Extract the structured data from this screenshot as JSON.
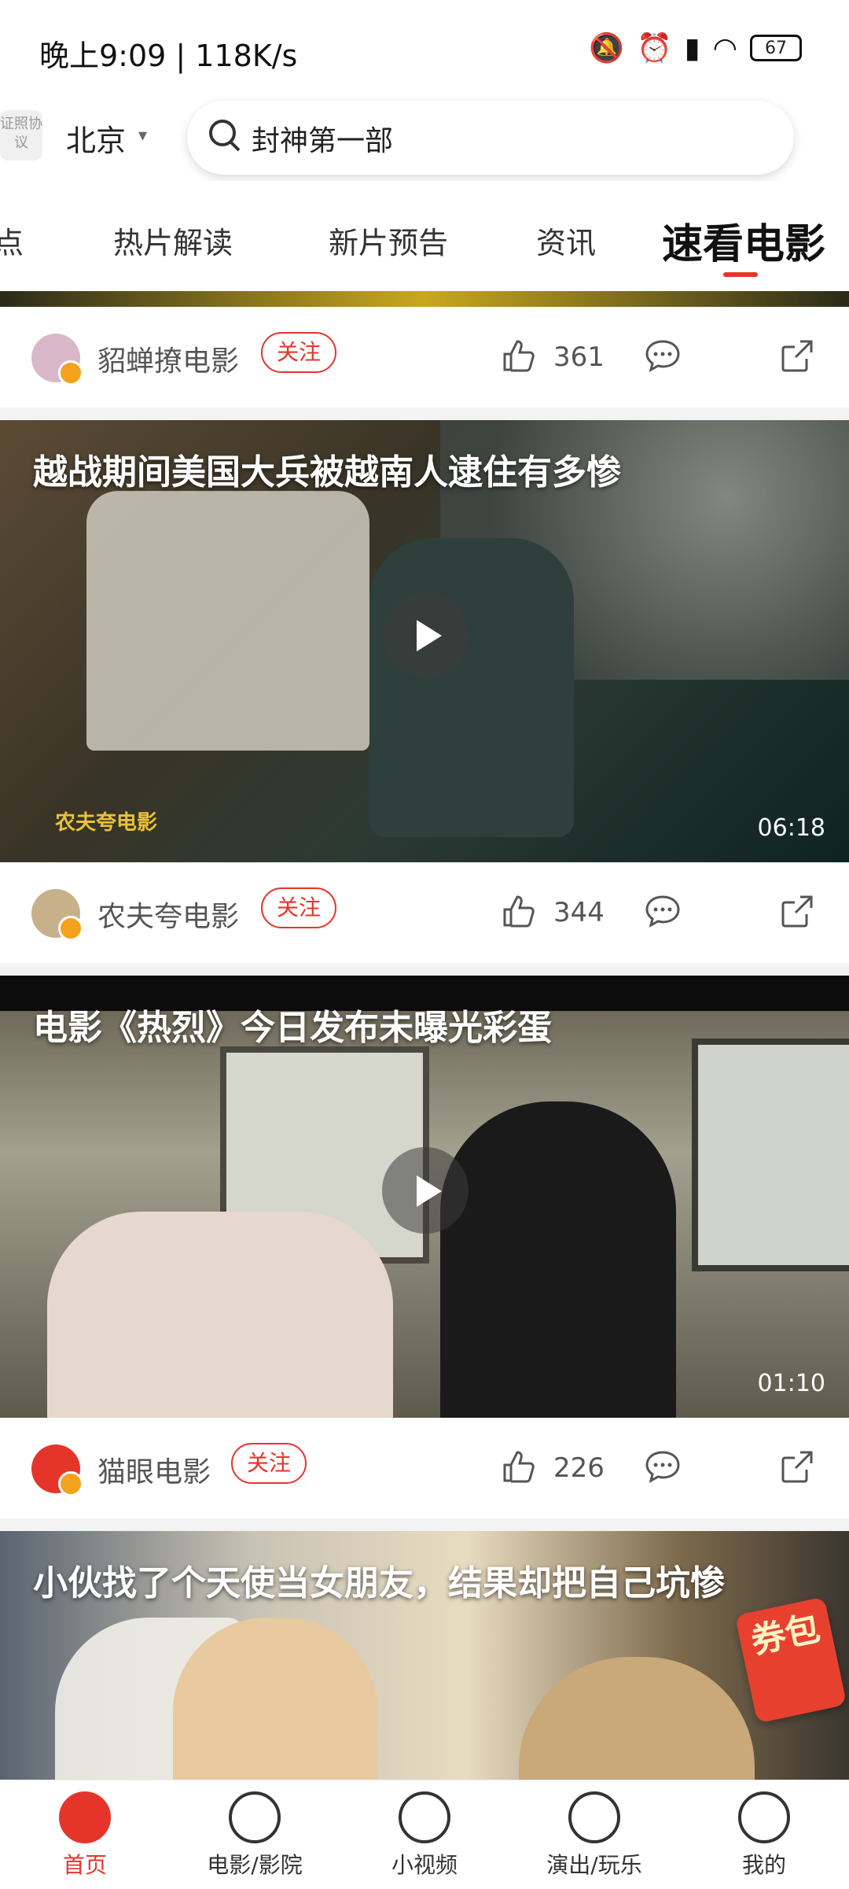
{
  "status_bar": {
    "time": "晚上9:09 | 118K/s",
    "battery": "67"
  },
  "header": {
    "agreement": "证照协议",
    "city": "北京",
    "search_text": "封神第一部"
  },
  "tabs": [
    "点",
    "热片解读",
    "新片预告",
    "资讯",
    "速看电影"
  ],
  "active_tab": "速看电影",
  "top_author": {
    "name": "貂蝉撩电影",
    "follow": "关注",
    "likes": "361"
  },
  "videos": [
    {
      "title": "越战期间美国大兵被越南人逮住有多惨",
      "duration": "06:18",
      "watermark": "农夫夸电影",
      "author": "农夫夸电影",
      "follow": "关注",
      "likes": "344"
    },
    {
      "title": "电影《热烈》今日发布未曝光彩蛋",
      "duration": "01:10",
      "author": "猫眼电影",
      "follow": "关注",
      "likes": "226"
    },
    {
      "title": "小伙找了个天使当女朋友，结果却把自己坑惨"
    }
  ],
  "coupon": "券包",
  "bottom_nav": [
    "首页",
    "电影/影院",
    "小视频",
    "演出/玩乐",
    "我的"
  ],
  "colors": {
    "accent": "#e5352b"
  }
}
